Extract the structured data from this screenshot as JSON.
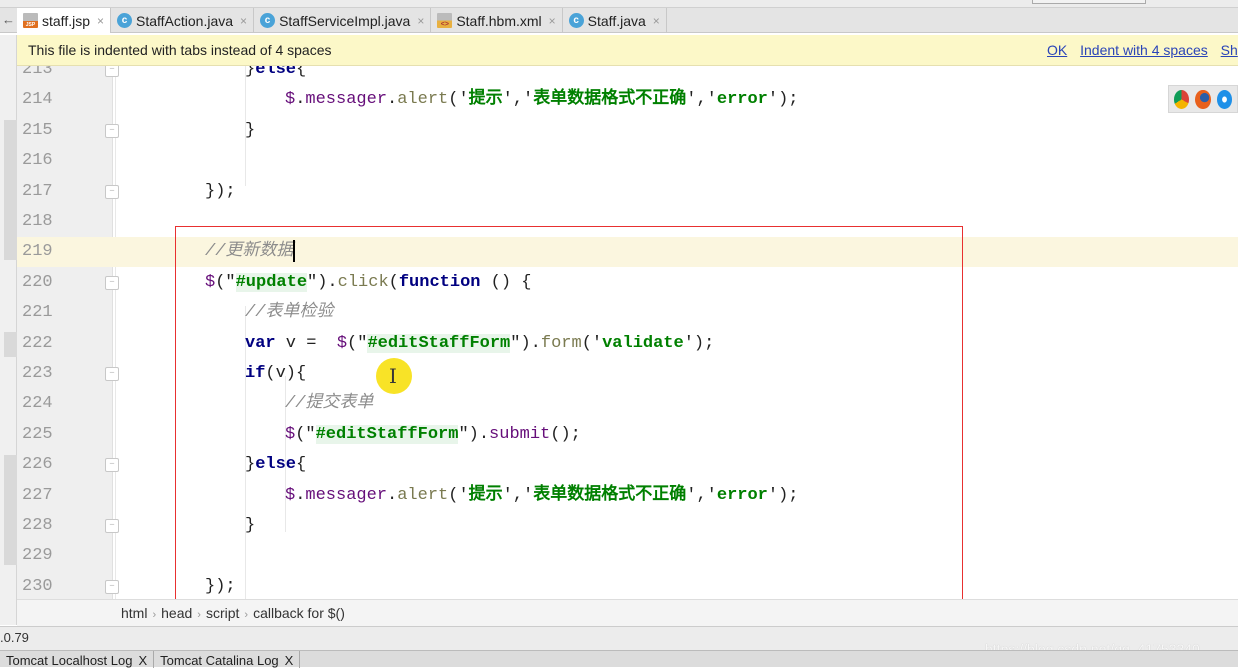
{
  "tabs": [
    {
      "label": "staff.jsp",
      "icon": "jsp-file-icon",
      "active": true
    },
    {
      "label": "StaffAction.java",
      "icon": "java-class-icon"
    },
    {
      "label": "StaffServiceImpl.java",
      "icon": "java-class-icon"
    },
    {
      "label": "Staff.hbm.xml",
      "icon": "xml-file-icon"
    },
    {
      "label": "Staff.java",
      "icon": "java-class-icon"
    }
  ],
  "tab_close": "×",
  "notice": {
    "text": "This file is indented with tabs instead of 4 spaces",
    "ok": "OK",
    "indent": "Indent with 4 spaces",
    "show": "Sh"
  },
  "code_lines": [
    {
      "n": "213",
      "fold": true,
      "tokens": [
        [
          "}",
          "pl",
          2
        ],
        [
          "else",
          "kw"
        ],
        [
          "{",
          "pl"
        ]
      ]
    },
    {
      "n": "214",
      "tokens": [
        [
          "$",
          "pr",
          3
        ],
        [
          ".",
          "pl"
        ],
        [
          "messager",
          "pr"
        ],
        [
          ".",
          "pl"
        ],
        [
          "alert",
          "fn"
        ],
        [
          "('",
          "pl"
        ],
        [
          "提示",
          "str"
        ],
        [
          "','",
          "pl"
        ],
        [
          "表单数据格式不正确",
          "str"
        ],
        [
          "','",
          "pl"
        ],
        [
          "error",
          "str"
        ],
        [
          "');",
          "pl"
        ]
      ]
    },
    {
      "n": "215",
      "fold": true,
      "tokens": [
        [
          "}",
          "pl",
          2
        ]
      ]
    },
    {
      "n": "216",
      "tokens": []
    },
    {
      "n": "217",
      "fold": true,
      "tokens": [
        [
          "});",
          "pl",
          1
        ]
      ]
    },
    {
      "n": "218",
      "tokens": []
    },
    {
      "n": "219",
      "current": true,
      "tokens": [
        [
          "//更新数据",
          "cm",
          1
        ]
      ]
    },
    {
      "n": "220",
      "fold": true,
      "tokens": [
        [
          "$",
          "pr",
          1
        ],
        [
          "(\"",
          "pl"
        ],
        [
          "#update",
          "strhl"
        ],
        [
          "\").",
          "pl"
        ],
        [
          "click",
          "fn"
        ],
        [
          "(",
          "pl"
        ],
        [
          "function",
          "kw"
        ],
        [
          " () {",
          "pl"
        ]
      ]
    },
    {
      "n": "221",
      "tokens": [
        [
          "//表单检验",
          "cm",
          2
        ]
      ]
    },
    {
      "n": "222",
      "tokens": [
        [
          "var",
          "kw",
          2
        ],
        [
          " v =  ",
          "pl"
        ],
        [
          "$",
          "pr"
        ],
        [
          "(\"",
          "pl"
        ],
        [
          "#editStaffForm",
          "strhl"
        ],
        [
          "\").",
          "pl"
        ],
        [
          "form",
          "fn"
        ],
        [
          "('",
          "pl"
        ],
        [
          "validate",
          "str"
        ],
        [
          "');",
          "pl"
        ]
      ]
    },
    {
      "n": "223",
      "fold": true,
      "tokens": [
        [
          "if",
          "kw",
          2
        ],
        [
          "(v){",
          "pl"
        ]
      ]
    },
    {
      "n": "224",
      "tokens": [
        [
          "//提交表单",
          "cm",
          3
        ]
      ]
    },
    {
      "n": "225",
      "tokens": [
        [
          "$",
          "pr",
          3
        ],
        [
          "(\"",
          "pl"
        ],
        [
          "#editStaffForm",
          "strhl"
        ],
        [
          "\").",
          "pl"
        ],
        [
          "submit",
          "pr"
        ],
        [
          "();",
          "pl"
        ]
      ]
    },
    {
      "n": "226",
      "fold": true,
      "tokens": [
        [
          "}",
          "pl",
          2
        ],
        [
          "else",
          "kw"
        ],
        [
          "{",
          "pl"
        ]
      ]
    },
    {
      "n": "227",
      "tokens": [
        [
          "$",
          "pr",
          3
        ],
        [
          ".",
          "pl"
        ],
        [
          "messager",
          "pr"
        ],
        [
          ".",
          "pl"
        ],
        [
          "alert",
          "fn"
        ],
        [
          "('",
          "pl"
        ],
        [
          "提示",
          "str"
        ],
        [
          "','",
          "pl"
        ],
        [
          "表单数据格式不正确",
          "str"
        ],
        [
          "','",
          "pl"
        ],
        [
          "error",
          "str"
        ],
        [
          "');",
          "pl"
        ]
      ]
    },
    {
      "n": "228",
      "fold": true,
      "tokens": [
        [
          "}",
          "pl",
          2
        ]
      ]
    },
    {
      "n": "229",
      "tokens": []
    },
    {
      "n": "230",
      "fold": true,
      "tokens": [
        [
          "});",
          "pl",
          1
        ]
      ]
    }
  ],
  "breadcrumb": [
    "html",
    "head",
    "script",
    "callback for $()"
  ],
  "breadcrumb_sep": "›",
  "status": {
    "text": ".0.79"
  },
  "watermark": "https://blog.csdn.net/qq_41753340",
  "bottom_tabs": [
    {
      "label": "Tomcat Localhost Log"
    },
    {
      "label": "Tomcat Catalina Log"
    }
  ],
  "bottom_close": "X",
  "cursor_glyph": "I",
  "browser_icons": [
    "chrome-icon",
    "firefox-icon",
    "safari-icon"
  ],
  "colors": {
    "keyword": "#000080",
    "string": "#008000",
    "comment": "#8c8c8c",
    "member": "#660e7a",
    "highlight": "#e83030"
  }
}
